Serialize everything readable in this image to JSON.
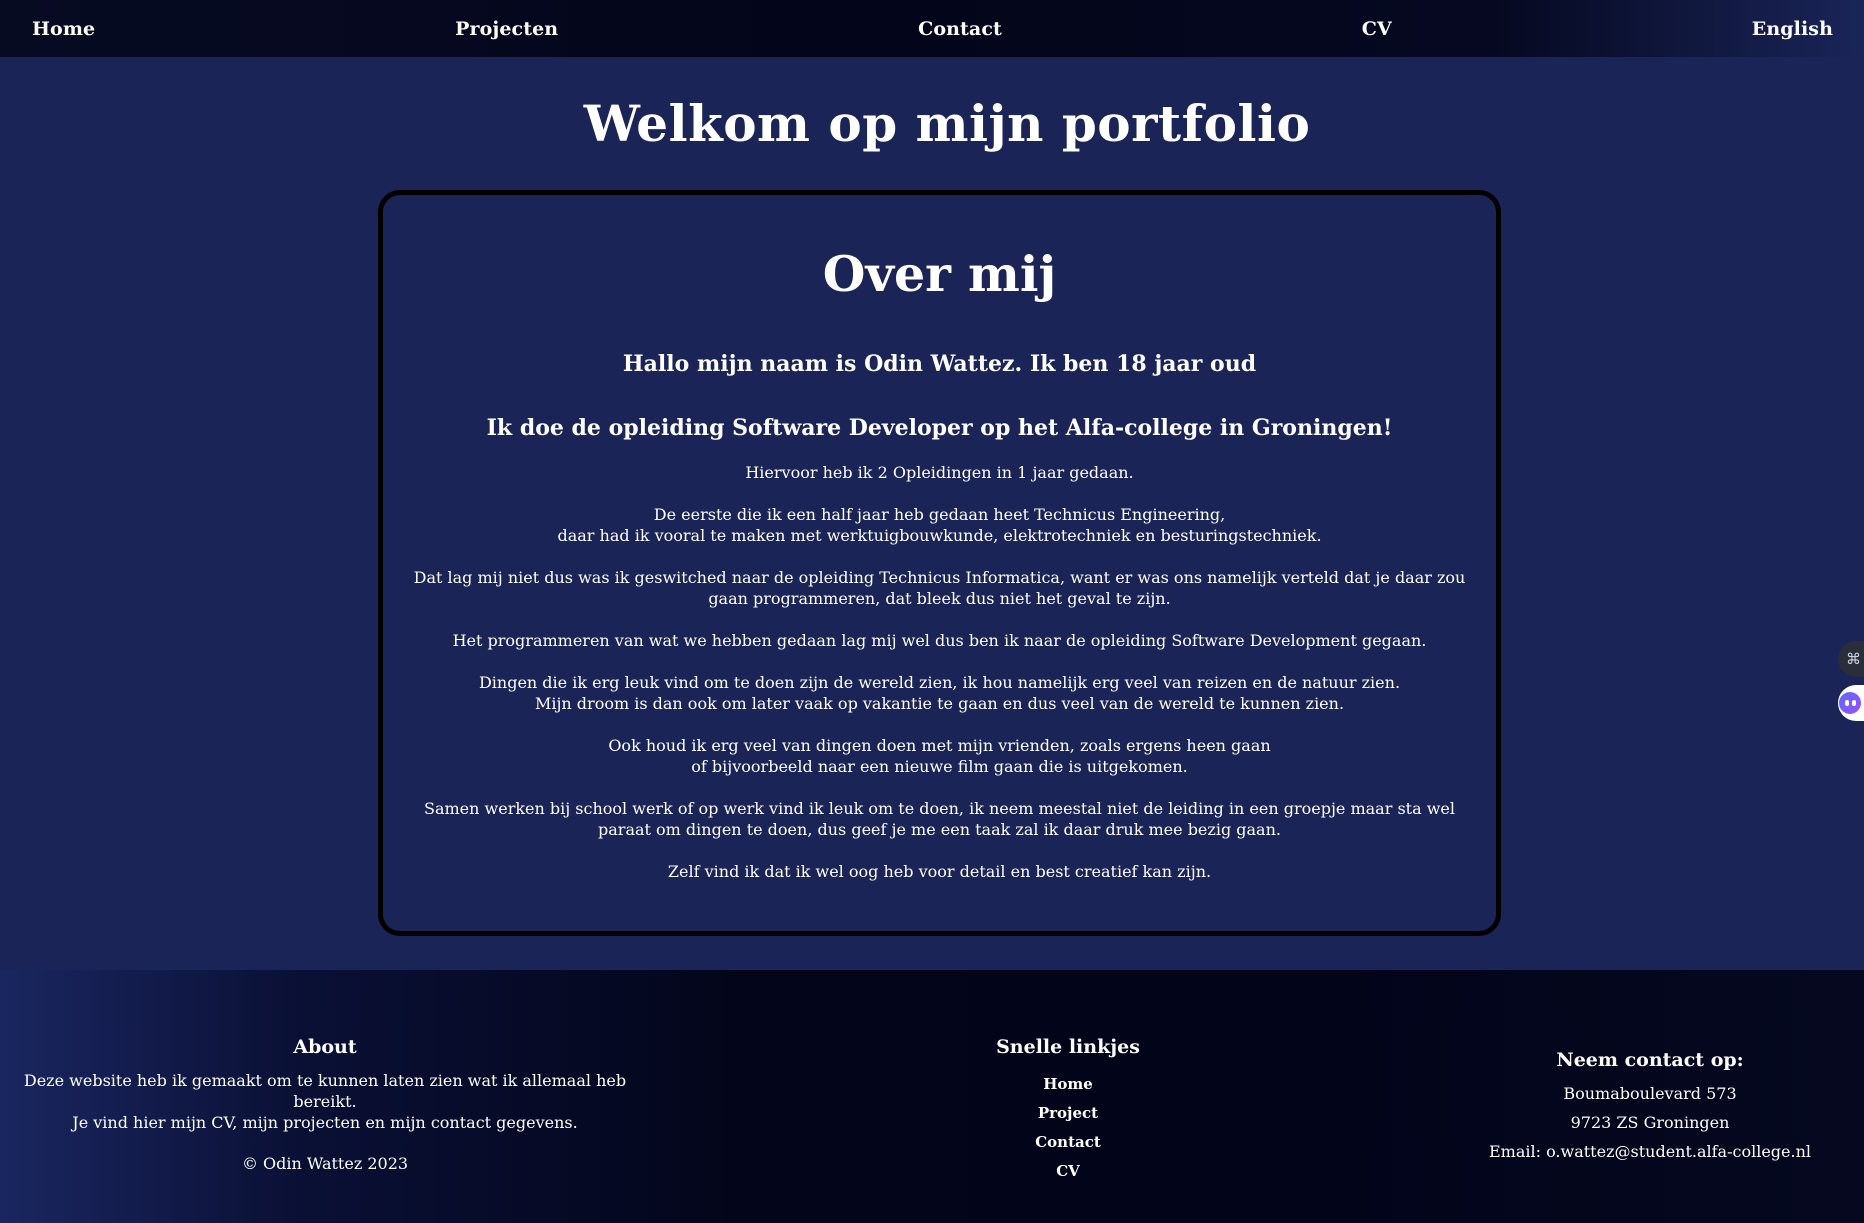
{
  "nav": {
    "home": "Home",
    "projects": "Projecten",
    "contact": "Contact",
    "cv": "CV",
    "language": "English"
  },
  "main": {
    "title": "Welkom op mijn portfolio",
    "card": {
      "title": "Over mij",
      "subtitle1": "Hallo mijn naam is Odin Wattez. Ik ben 18 jaar oud",
      "subtitle2": "Ik doe de opleiding Software Developer op het Alfa-college in Groningen!",
      "p1": "Hiervoor heb ik 2 Opleidingen in 1 jaar gedaan.",
      "p2a": "De eerste die ik een half jaar heb gedaan heet Technicus Engineering,",
      "p2b": "daar had ik vooral te maken met werktuigbouwkunde, elektrotechniek en besturingstechniek.",
      "p3": "Dat lag mij niet dus was ik geswitched naar de opleiding Technicus Informatica, want er was ons namelijk verteld dat je daar zou gaan programmeren, dat bleek dus niet het geval te zijn.",
      "p4": "Het programmeren van wat we hebben gedaan lag mij wel dus ben ik naar de opleiding Software Development gegaan.",
      "p5a": "Dingen die ik erg leuk vind om te doen zijn de wereld zien, ik hou namelijk erg veel van reizen en de natuur zien.",
      "p5b": "Mijn droom is dan ook om later vaak op vakantie te gaan en dus veel van de wereld te kunnen zien.",
      "p6a": "Ook houd ik erg veel van dingen doen met mijn vrienden, zoals ergens heen gaan",
      "p6b": "of bijvoorbeeld naar een nieuwe film gaan die is uitgekomen.",
      "p7": "Samen werken bij school werk of op werk vind ik leuk om te doen, ik neem meestal niet de leiding in een groepje maar sta wel paraat om dingen te doen, dus geef je me een taak zal ik daar druk mee bezig gaan.",
      "p8": "Zelf vind ik dat ik wel oog heb voor detail en best creatief kan zijn."
    }
  },
  "side_widgets": {
    "widget1_icon": "grid-icon",
    "widget2_icon": "assistant-bot-icon"
  },
  "footer": {
    "about": {
      "heading": "About",
      "line1": "Deze website heb ik gemaakt om te kunnen laten zien wat ik allemaal heb bereikt.",
      "line2": "Je vind hier mijn CV, mijn projecten en mijn contact gegevens.",
      "copyright": "© Odin Wattez 2023"
    },
    "links": {
      "heading": "Snelle linkjes",
      "home": "Home",
      "project": "Project",
      "contact": "Contact",
      "cv": "CV"
    },
    "contact": {
      "heading": "Neem contact op:",
      "street": "Boumaboulevard 573",
      "city": "9723 ZS Groningen",
      "email": "Email: o.wattez@student.alfa-college.nl"
    }
  },
  "colors": {
    "background": "#1a2456",
    "nav_dark": "#03051a",
    "card_border": "#000000",
    "text": "#ffffff"
  }
}
